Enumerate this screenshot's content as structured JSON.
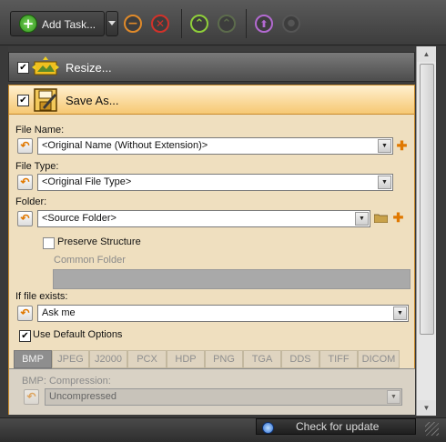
{
  "toolbar": {
    "add_task_label": "Add Task..."
  },
  "resize": {
    "title": "Resize...",
    "checked": "✔"
  },
  "save_as": {
    "title": "Save As...",
    "checked": "✔",
    "file_name": {
      "label": "File Name:",
      "value": "<Original Name (Without Extension)>"
    },
    "file_type": {
      "label": "File Type:",
      "value": "<Original File Type>"
    },
    "folder": {
      "label": "Folder:",
      "value": "<Source Folder>"
    },
    "preserve_structure": {
      "label": "Preserve Structure",
      "checked": false
    },
    "common_folder": {
      "label": "Common Folder",
      "value": ""
    },
    "if_exists": {
      "label": "If file exists:",
      "value": "Ask me"
    },
    "use_default": {
      "label": "Use Default Options",
      "checked": "✔"
    },
    "format_tabs": [
      "BMP",
      "JPEG",
      "J2000",
      "PCX",
      "HDP",
      "PNG",
      "TGA",
      "DDS",
      "TIFF",
      "DICOM"
    ],
    "active_tab": "BMP",
    "compression": {
      "label": "BMP: Compression:",
      "value": "Uncompressed"
    }
  },
  "status": {
    "update_label": "Check for update"
  },
  "colors": {
    "accent_orange": "#e07800",
    "header_active": "#f6c873",
    "panel_body": "#efdfbf"
  },
  "icons": {
    "add": "plus-circle-green",
    "remove": "minus-circle-orange",
    "clear": "x-circle-red",
    "move_up": "up-arc-green",
    "move_down": "down-arc-green-disabled",
    "run": "up-circle-purple",
    "stop": "circle-disabled"
  }
}
